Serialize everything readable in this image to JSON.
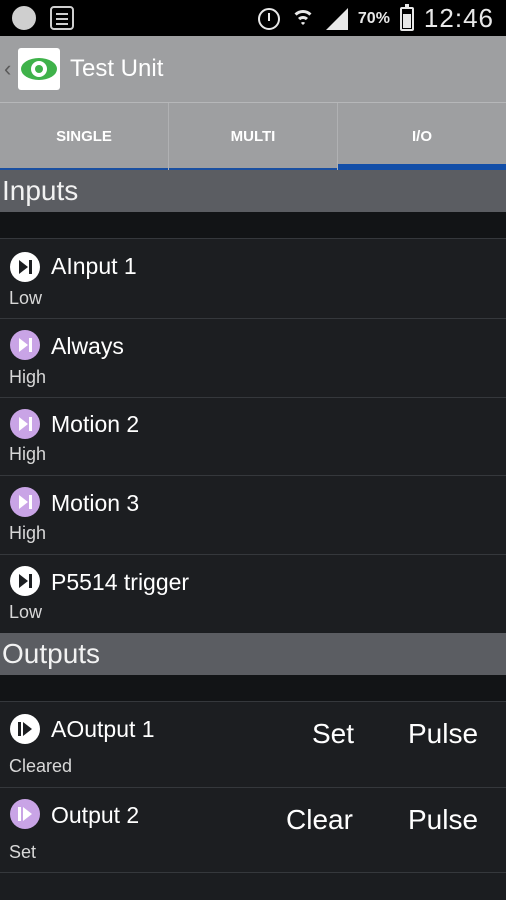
{
  "status_bar": {
    "battery_percent": "70%",
    "battery_level": 0.7,
    "time": "12:46"
  },
  "action_bar": {
    "title": "Test Unit"
  },
  "tabs": [
    {
      "label": "SINGLE",
      "active": false
    },
    {
      "label": "MULTI",
      "active": false
    },
    {
      "label": "I/O",
      "active": true
    }
  ],
  "inputs": {
    "header": "Inputs",
    "items": [
      {
        "name": "AInput 1",
        "state": "Low",
        "icon": "play-pause-icon"
      },
      {
        "name": "Always",
        "state": "High",
        "icon": "play-pause-icon"
      },
      {
        "name": "Motion 2",
        "state": "High",
        "icon": "play-pause-icon"
      },
      {
        "name": "Motion 3",
        "state": "High",
        "icon": "play-pause-icon"
      },
      {
        "name": "P5514 trigger",
        "state": "Low",
        "icon": "play-pause-icon"
      }
    ]
  },
  "outputs": {
    "header": "Outputs",
    "items": [
      {
        "name": "AOutput 1",
        "state": "Cleared",
        "action": "Set",
        "pulse": "Pulse",
        "icon": "pause-play-icon"
      },
      {
        "name": "Output 2",
        "state": "Set",
        "action": "Clear",
        "pulse": "Pulse",
        "icon": "pause-play-icon"
      }
    ]
  },
  "colors": {
    "accent_blue": "#124ea8",
    "logo_green": "#3fb24a",
    "icon_purple": "#c9a4e6",
    "bar_gray": "#9e9fa1",
    "section_gray": "#5b5d62"
  }
}
